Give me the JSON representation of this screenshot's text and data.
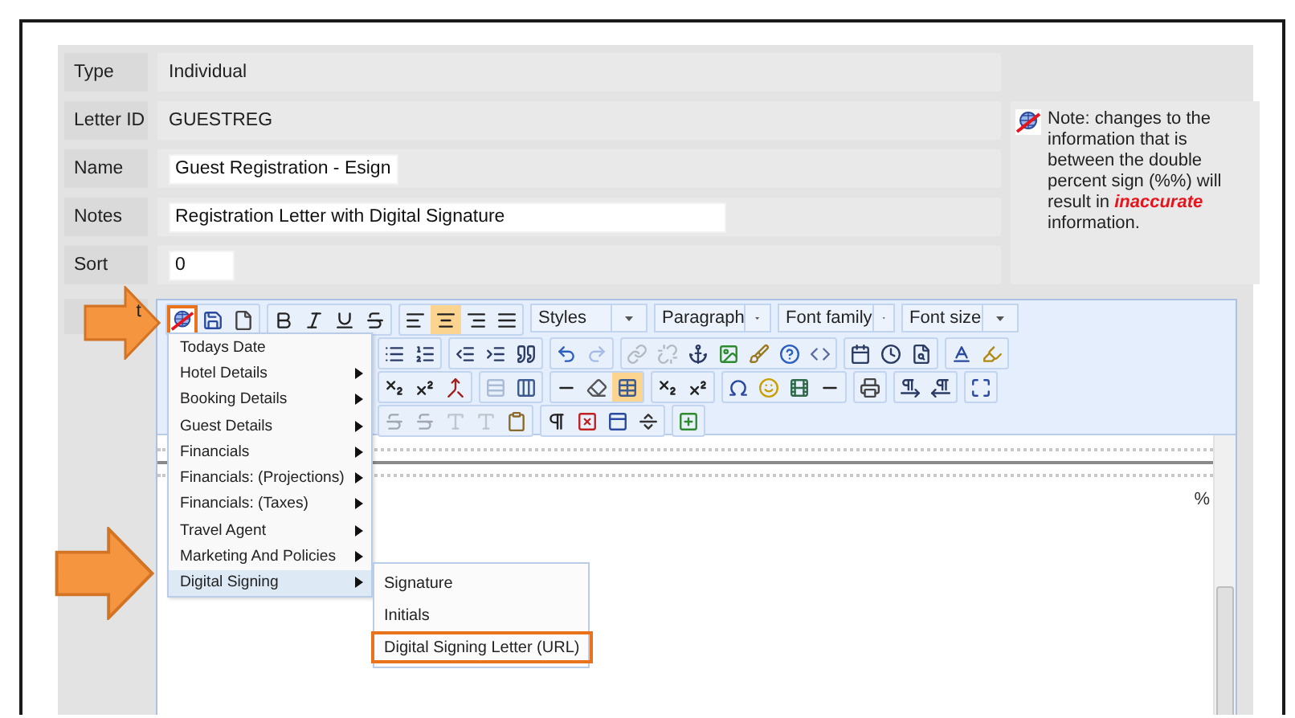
{
  "form": {
    "rows": [
      {
        "label": "Type",
        "value": "Individual",
        "kind": "text"
      },
      {
        "label": "Letter ID",
        "value": "GUESTREG",
        "kind": "text"
      },
      {
        "label": "Name",
        "value": "Guest Registration - Esign",
        "kind": "input"
      },
      {
        "label": "Notes",
        "value": "Registration Letter with Digital Signature",
        "kind": "input"
      },
      {
        "label": "Sort",
        "value": "0",
        "kind": "input"
      }
    ]
  },
  "note": {
    "text": "Note: changes to the information that is between the double percent sign (%%) will result in *inaccurate* information."
  },
  "editor": {
    "label": "t",
    "toolbar": {
      "rows": [
        {
          "groups": [
            [
              {
                "kind": "insert-field",
                "active": false,
                "disabled": false,
                "outlined": true
              },
              {
                "kind": "save",
                "active": false,
                "disabled": false,
                "outlined": false
              },
              {
                "kind": "new-document",
                "active": false,
                "disabled": false,
                "outlined": false
              }
            ],
            [
              {
                "kind": "bold",
                "active": false,
                "disabled": false,
                "outlined": false
              },
              {
                "kind": "italic",
                "active": false,
                "disabled": false,
                "outlined": false
              },
              {
                "kind": "underline",
                "active": false,
                "disabled": false,
                "outlined": false
              },
              {
                "kind": "strikethrough",
                "active": false,
                "disabled": false,
                "outlined": false
              }
            ],
            [
              {
                "kind": "align-left",
                "active": false,
                "disabled": false,
                "outlined": false
              },
              {
                "kind": "align-center",
                "active": true,
                "disabled": false,
                "outlined": false
              },
              {
                "kind": "align-right",
                "active": false,
                "disabled": false,
                "outlined": false
              },
              {
                "kind": "align-justify",
                "active": false,
                "disabled": false,
                "outlined": false
              }
            ]
          ],
          "selects": [
            "Styles",
            "Paragraph",
            "Font family",
            "Font size"
          ]
        },
        {
          "groups": [
            [
              {
                "kind": "bullet-list",
                "active": false,
                "disabled": false,
                "outlined": false
              },
              {
                "kind": "numbered-list",
                "active": false,
                "disabled": false,
                "outlined": false
              }
            ],
            [
              {
                "kind": "outdent",
                "active": false,
                "disabled": false,
                "outlined": false
              },
              {
                "kind": "indent",
                "active": false,
                "disabled": false,
                "outlined": false
              },
              {
                "kind": "quote",
                "active": false,
                "disabled": false,
                "outlined": false
              }
            ],
            [
              {
                "kind": "undo",
                "active": false,
                "disabled": false,
                "outlined": false
              },
              {
                "kind": "redo",
                "active": false,
                "disabled": true,
                "outlined": false
              }
            ],
            [
              {
                "kind": "link",
                "active": false,
                "disabled": true,
                "outlined": false
              },
              {
                "kind": "unlink",
                "active": false,
                "disabled": true,
                "outlined": false
              },
              {
                "kind": "anchor",
                "active": false,
                "disabled": false,
                "outlined": false
              },
              {
                "kind": "image",
                "active": false,
                "disabled": false,
                "outlined": false
              },
              {
                "kind": "brush",
                "active": false,
                "disabled": false,
                "outlined": false
              },
              {
                "kind": "help",
                "active": false,
                "disabled": false,
                "outlined": false
              },
              {
                "kind": "code",
                "active": false,
                "disabled": false,
                "outlined": false
              }
            ],
            [
              {
                "kind": "calendar",
                "active": false,
                "disabled": false,
                "outlined": false
              },
              {
                "kind": "clock",
                "active": false,
                "disabled": false,
                "outlined": false
              },
              {
                "kind": "preview",
                "active": false,
                "disabled": false,
                "outlined": false
              }
            ],
            [
              {
                "kind": "text-color",
                "active": false,
                "disabled": false,
                "outlined": false
              },
              {
                "kind": "highlight",
                "active": false,
                "disabled": false,
                "outlined": false
              }
            ]
          ],
          "selects": []
        },
        {
          "groups": [
            [
              {
                "kind": "subscript",
                "active": false,
                "disabled": false,
                "outlined": false
              },
              {
                "kind": "superscript",
                "active": false,
                "disabled": false,
                "outlined": false
              },
              {
                "kind": "merge",
                "active": false,
                "disabled": false,
                "outlined": false
              }
            ],
            [
              {
                "kind": "rows",
                "active": false,
                "disabled": true,
                "outlined": false
              },
              {
                "kind": "columns",
                "active": false,
                "disabled": false,
                "outlined": false
              }
            ],
            [
              {
                "kind": "horizontal-rule",
                "active": false,
                "disabled": false,
                "outlined": false
              },
              {
                "kind": "eraser",
                "active": false,
                "disabled": false,
                "outlined": false
              },
              {
                "kind": "table",
                "active": true,
                "disabled": false,
                "outlined": false
              }
            ],
            [
              {
                "kind": "subscript",
                "active": false,
                "disabled": false,
                "outlined": false
              },
              {
                "kind": "superscript",
                "active": false,
                "disabled": false,
                "outlined": false
              }
            ],
            [
              {
                "kind": "omega",
                "active": false,
                "disabled": false,
                "outlined": false
              },
              {
                "kind": "smile",
                "active": false,
                "disabled": false,
                "outlined": false
              },
              {
                "kind": "film",
                "active": false,
                "disabled": false,
                "outlined": false
              },
              {
                "kind": "horizontal-rule",
                "active": false,
                "disabled": false,
                "outlined": false
              }
            ],
            [
              {
                "kind": "print",
                "active": false,
                "disabled": false,
                "outlined": false
              }
            ],
            [
              {
                "kind": "ltr",
                "active": false,
                "disabled": false,
                "outlined": false
              },
              {
                "kind": "rtl",
                "active": false,
                "disabled": false,
                "outlined": false
              }
            ],
            [
              {
                "kind": "fullscreen",
                "active": false,
                "disabled": false,
                "outlined": false
              }
            ]
          ],
          "selects": []
        },
        {
          "groups": [
            [
              {
                "kind": "strikethrough",
                "active": false,
                "disabled": true,
                "outlined": false
              },
              {
                "kind": "strikethrough",
                "active": false,
                "disabled": true,
                "outlined": false
              },
              {
                "kind": "type",
                "active": false,
                "disabled": true,
                "outlined": false
              },
              {
                "kind": "type",
                "active": false,
                "disabled": true,
                "outlined": false
              },
              {
                "kind": "paste",
                "active": false,
                "disabled": false,
                "outlined": false
              }
            ],
            [
              {
                "kind": "pilcrow",
                "active": false,
                "disabled": false,
                "outlined": false
              },
              {
                "kind": "no-entry",
                "active": false,
                "disabled": false,
                "outlined": false
              },
              {
                "kind": "layer",
                "active": false,
                "disabled": false,
                "outlined": false
              },
              {
                "kind": "page-break",
                "active": false,
                "disabled": false,
                "outlined": false
              }
            ],
            [
              {
                "kind": "insert-block",
                "active": false,
                "disabled": false,
                "outlined": false
              }
            ]
          ],
          "selects": []
        }
      ]
    },
    "content": {
      "text": "%"
    },
    "menu": {
      "items": [
        {
          "label": "Todays Date",
          "submenu": false,
          "selected": false
        },
        {
          "label": "Hotel Details",
          "submenu": true,
          "selected": false
        },
        {
          "label": "Booking Details",
          "submenu": true,
          "selected": false
        },
        {
          "label": "Guest Details",
          "submenu": true,
          "selected": false
        },
        {
          "label": "Financials",
          "submenu": true,
          "selected": false
        },
        {
          "label": "Financials: (Projections)",
          "submenu": true,
          "selected": false
        },
        {
          "label": "Financials: (Taxes)",
          "submenu": true,
          "selected": false
        },
        {
          "label": "Travel Agent",
          "submenu": true,
          "selected": false
        },
        {
          "label": "Marketing And Policies",
          "submenu": true,
          "selected": false
        },
        {
          "label": "Digital Signing",
          "submenu": true,
          "selected": true
        }
      ]
    },
    "submenu": {
      "items": [
        {
          "label": "Signature",
          "highlighted": false
        },
        {
          "label": "Initials",
          "highlighted": false
        },
        {
          "label": "Digital Signing Letter (URL)",
          "highlighted": true
        }
      ]
    }
  }
}
